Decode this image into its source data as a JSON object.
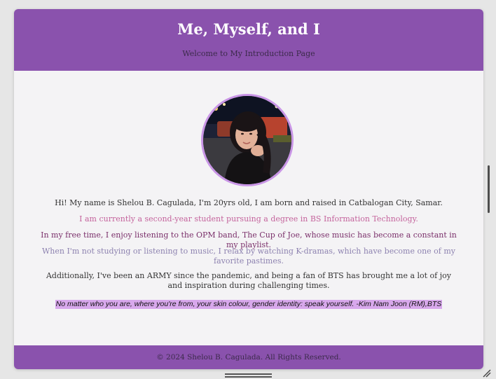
{
  "header": {
    "title": "Me, Myself, and I",
    "subtitle": "Welcome to My Introduction Page"
  },
  "profile": {
    "avatar_icon": "profile-photo"
  },
  "content": {
    "p1": "Hi! My name is Shelou B. Cagulada, I'm 20yrs old, I am born and raised in Catbalogan City, Samar.",
    "p2": "I am currently a second-year student pursuing a degree in BS Information Technology.",
    "p3": "In my free time, I enjoy listening to the OPM band, The Cup of Joe, whose music has become a constant in my playlist.",
    "p4": "When I'm not studying or listening to music, I relax by watching K-dramas, which have become one of my favorite pastimes.",
    "p5": "Additionally, I've been an ARMY since the pandemic, and being a fan of BTS has brought me a lot of joy and inspiration during challenging times.",
    "quote": "No matter who you are, where you're from, your skin colour, gender identity: speak yourself. -Kim Nam Joon (RM),BTS"
  },
  "footer": {
    "copyright": "© 2024 Shelou B. Cagulada. All Rights Reserved."
  },
  "colors": {
    "accent": "#8a52ad",
    "avatar_border": "#c995e6",
    "quote_highlight": "#d8a8ec"
  }
}
